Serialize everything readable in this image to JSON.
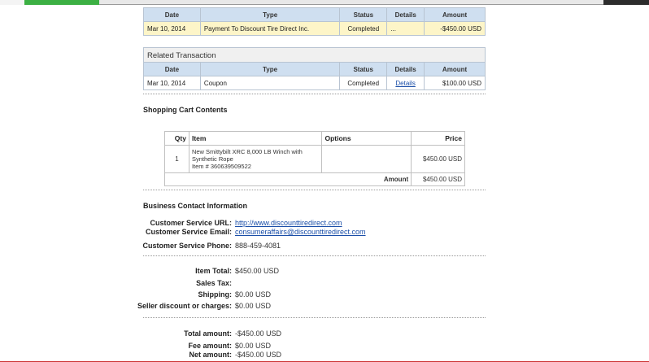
{
  "transaction": {
    "headers": [
      "Date",
      "Type",
      "Status",
      "Details",
      "Amount"
    ],
    "row": {
      "date": "Mar 10, 2014",
      "type": "Payment To Discount Tire Direct Inc.",
      "status": "Completed",
      "details": "...",
      "amount": "-$450.00 USD"
    }
  },
  "related": {
    "title": "Related Transaction",
    "headers": [
      "Date",
      "Type",
      "Status",
      "Details",
      "Amount"
    ],
    "row": {
      "date": "Mar 10, 2014",
      "type": "Coupon",
      "status": "Completed",
      "details": "Details",
      "amount": "$100.00 USD"
    }
  },
  "cart": {
    "title": "Shopping Cart Contents",
    "headers": {
      "qty": "Qty",
      "item": "Item",
      "options": "Options",
      "price": "Price"
    },
    "item": {
      "qty": "1",
      "name_line1": "New Smittybilt XRC 8,000 LB Winch with",
      "name_line2": "Synthetic Rope",
      "item_number": "Item # 360639509522",
      "options": "",
      "price": "$450.00 USD"
    },
    "amount_label": "Amount",
    "amount_value": "$450.00 USD"
  },
  "contact": {
    "title": "Business Contact Information",
    "url_label": "Customer Service URL:",
    "url_value": "http://www.discounttiredirect.com",
    "email_label": "Customer Service Email:",
    "email_value": "consumeraffairs@discounttiredirect.com",
    "phone_label": "Customer Service Phone:",
    "phone_value": "888-459-4081"
  },
  "totals": {
    "item_total_label": "Item Total:",
    "item_total_value": "$450.00 USD",
    "sales_tax_label": "Sales Tax:",
    "sales_tax_value": "",
    "shipping_label": "Shipping:",
    "shipping_value": "$0.00 USD",
    "discount_label": "Seller discount or charges:",
    "discount_value": "$0.00 USD"
  },
  "summary": {
    "total_label": "Total amount:",
    "total_value": "-$450.00 USD",
    "fee_label": "Fee amount:",
    "fee_value": "$0.00 USD",
    "net_label": "Net amount:",
    "net_value": "-$450.00 USD"
  }
}
